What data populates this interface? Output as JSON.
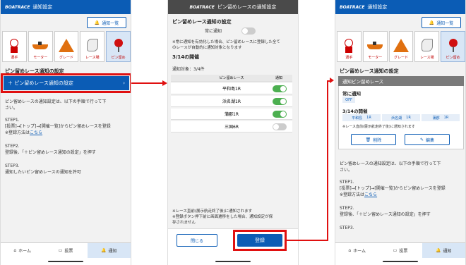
{
  "app_title": "通知設定",
  "brand": "BOATRACE",
  "topbtn": "通知一覧",
  "icons": [
    "選手",
    "モーター",
    "グレード",
    "レース場",
    "ピン留め"
  ],
  "section_title": "ピン留めレース通知の設定",
  "add_button": "＋ ピン留めレース通知の設定",
  "desc_1": "ピン留めレースの通知設定は、以下の手順で行って下",
  "desc_2": "さい。",
  "step1_title": "STEP1.",
  "step1_line1": "[投票]→[トップ]→[開催一覧]からピン留めレースを登録",
  "step1_line2_pre": "※登録方法は",
  "step1_link": "こちら",
  "step2_title": "STEP2.",
  "step2_line1": "登録後、「＋ピン留めレース通知の設定」を押す",
  "step3_title": "STEP3.",
  "step3_line1": "通知したいピン留めレースの通知を許可",
  "nav": [
    "ホーム",
    "投票",
    "通知"
  ],
  "mid": {
    "title": "ピン留めレースの通知設定",
    "sec": "ピン留めレース通知の設定",
    "always": "常に通知",
    "note1": "※常に通知を有効化した場合、ピン留めレースに登録した全て",
    "note2": "のレースが自動的に通知対象となります",
    "date": "3/14の開催",
    "count": "通知対象：3/4件",
    "col1": "ピン留めレース",
    "col2": "通知",
    "races": [
      "平和島1R",
      "浜名湖1R",
      "蒲郡1R",
      "三国6R"
    ],
    "foot1": "※レース直前(展示航走終了後)に通知されます",
    "foot2": "※登録ボタン押下前に画面遷移をした場合、通知設定が保",
    "foot3": "存されません",
    "close": "閉じる",
    "register": "登録"
  },
  "right": {
    "section_title": "ピン留めレース通知の設定",
    "box_title": "通知ピン留めレース",
    "always": "常に通知",
    "off": "OFF",
    "date": "3/14の開催",
    "races": [
      [
        "平和島",
        "1R"
      ],
      [
        "浜名湖",
        "1R"
      ],
      [
        "蒲郡",
        "1R"
      ]
    ],
    "note": "※レース直前(展示航走終了後)に通知されます",
    "delete": "削除",
    "edit": "編集",
    "desc_1": "ピン留めレースの通知設定は、以下の手順で行って下",
    "desc_2": "さい。",
    "step1_title": "STEP1.",
    "step1_line1": "[投票]→[トップ]→[開催一覧]からピン留めレースを登録",
    "step1_line2_pre": "※登録方法は",
    "step1_link": "こちら",
    "step2_title": "STEP2.",
    "step2_line1": "登録後、「＋ピン留めレース通知の設定」を押す",
    "step3_title": "STEP3."
  }
}
